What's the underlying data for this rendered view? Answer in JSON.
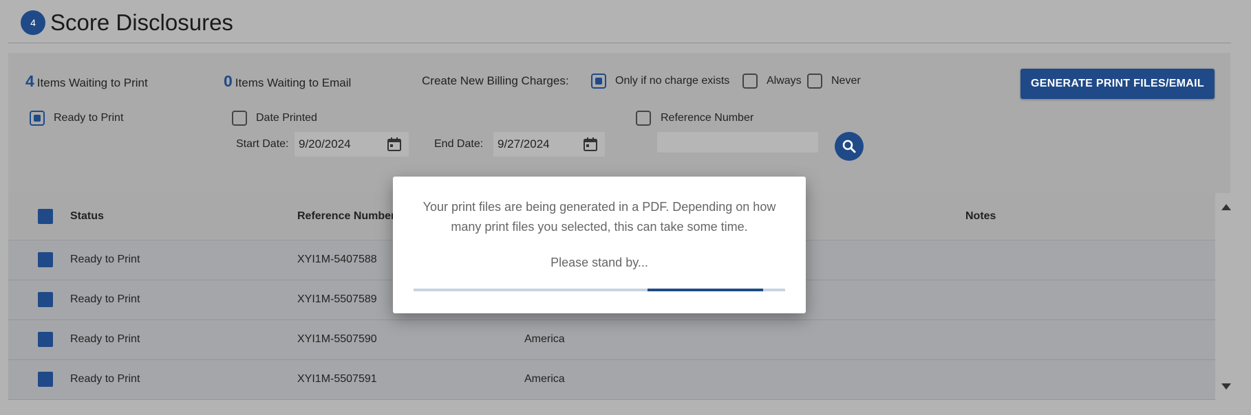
{
  "header": {
    "step": "4",
    "title": "Score Disclosures"
  },
  "counts": {
    "print_num": "4",
    "print_label": "Items Waiting to Print",
    "email_num": "0",
    "email_label": "Items Waiting to Email"
  },
  "billing": {
    "label": "Create New Billing Charges:",
    "options": [
      {
        "label": "Only if no charge exists",
        "checked": true
      },
      {
        "label": "Always",
        "checked": false
      },
      {
        "label": "Never",
        "checked": false
      }
    ]
  },
  "generate_button": "GENERATE PRINT FILES/EMAIL",
  "filters": {
    "ready_to_print": {
      "label": "Ready to Print",
      "checked": true
    },
    "date_printed": {
      "label": "Date Printed",
      "checked": false
    },
    "start_date_label": "Start Date:",
    "start_date": "9/20/2024",
    "end_date_label": "End Date:",
    "end_date": "9/27/2024",
    "reference_number": {
      "label": "Reference Number",
      "checked": false,
      "value": ""
    }
  },
  "table": {
    "columns": [
      "Status",
      "Reference Number",
      "Notes"
    ],
    "rows": [
      {
        "status": "Ready to Print",
        "reference": "XYI1M-5407588",
        "country": ""
      },
      {
        "status": "Ready to Print",
        "reference": "XYI1M-5507589",
        "country": ""
      },
      {
        "status": "Ready to Print",
        "reference": "XYI1M-5507590",
        "country": "America"
      },
      {
        "status": "Ready to Print",
        "reference": "XYI1M-5507591",
        "country": "America"
      }
    ]
  },
  "modal": {
    "message": "Your print files are being generated in a PDF. Depending on how many print files you selected, this can take some time.",
    "wait": "Please stand by...",
    "progress_start": 0.63,
    "progress_end": 0.94
  },
  "colors": {
    "accent": "#1f4a87",
    "overlay": "#b3b3b3"
  }
}
